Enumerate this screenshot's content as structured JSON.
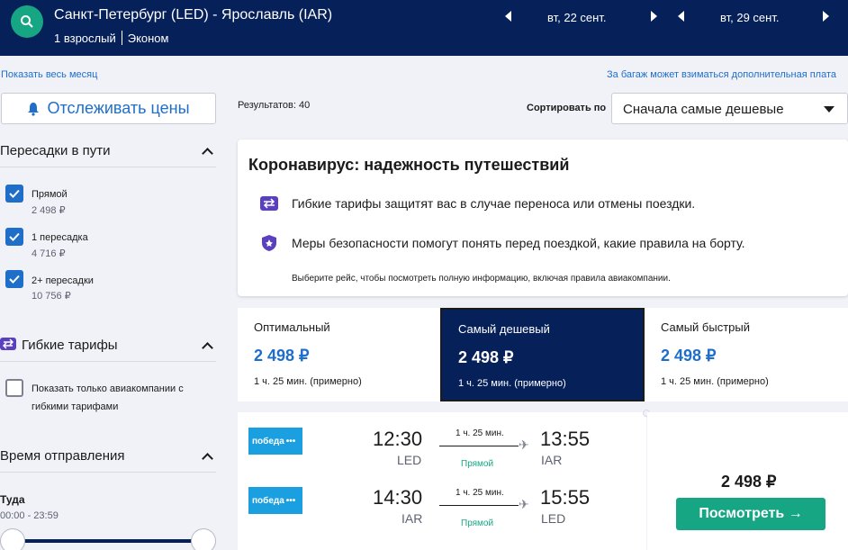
{
  "header": {
    "route": "Санкт-Петербург (LED) - Ярославль (IAR)",
    "passengers": "1 взрослый",
    "cabin": "Эконом",
    "date_out": "вт, 22 сент.",
    "date_back": "вт, 29 сент."
  },
  "links": {
    "whole_month": "Показать весь месяц",
    "baggage_note": "За багаж может взиматься дополнительная плата"
  },
  "sidebar": {
    "track_prices": "Отслеживать цены",
    "stops": {
      "title": "Пересадки в пути",
      "items": [
        {
          "label": "Прямой",
          "price": "2 498 ₽"
        },
        {
          "label": "1 пересадка",
          "price": "4 716 ₽"
        },
        {
          "label": "2+ пересадки",
          "price": "10 756 ₽"
        }
      ]
    },
    "flexible": {
      "title": "Гибкие тарифы",
      "option": "Показать только авиакомпании с гибкими тарифами"
    },
    "departure": {
      "title": "Время отправления",
      "direction": "Туда",
      "range": "00:00 - 23:59"
    }
  },
  "results": {
    "count_label": "Результатов: 40",
    "sort_label": "Сортировать по",
    "sort_value": "Сначала самые дешевые"
  },
  "covid": {
    "title": "Коронавирус: надежность путешествий",
    "line1": "Гибкие тарифы защитят вас в случае переноса или отмены поездки.",
    "line2": "Меры безопасности помогут понять перед поездкой, какие правила на борту.",
    "note": "Выберите рейс, чтобы посмотреть полную информацию, включая правила авиакомпании."
  },
  "tabs": [
    {
      "name": "Оптимальный",
      "price": "2 498 ₽",
      "duration": "1 ч. 25 мин. (примерно)"
    },
    {
      "name": "Самый дешевый",
      "price": "2 498 ₽",
      "duration": "1 ч. 25 мин. (примерно)"
    },
    {
      "name": "Самый быстрый",
      "price": "2 498 ₽",
      "duration": "1 ч. 25 мин. (примерно)"
    }
  ],
  "flight": {
    "airline": "победа",
    "legs": [
      {
        "dep_time": "12:30",
        "dep_code": "LED",
        "arr_time": "13:55",
        "arr_code": "IAR",
        "duration": "1 ч. 25 мин.",
        "stops": "Прямой"
      },
      {
        "dep_time": "14:30",
        "dep_code": "IAR",
        "arr_time": "15:55",
        "arr_code": "LED",
        "duration": "1 ч. 25 мин.",
        "stops": "Прямой"
      }
    ],
    "price": "2 498 ₽",
    "view_button": "Посмотреть →"
  },
  "colors": {
    "navy": "#06205a",
    "accent_blue": "#1f6ec9",
    "green": "#17a683",
    "pobeda_blue": "#1aa0e1"
  }
}
